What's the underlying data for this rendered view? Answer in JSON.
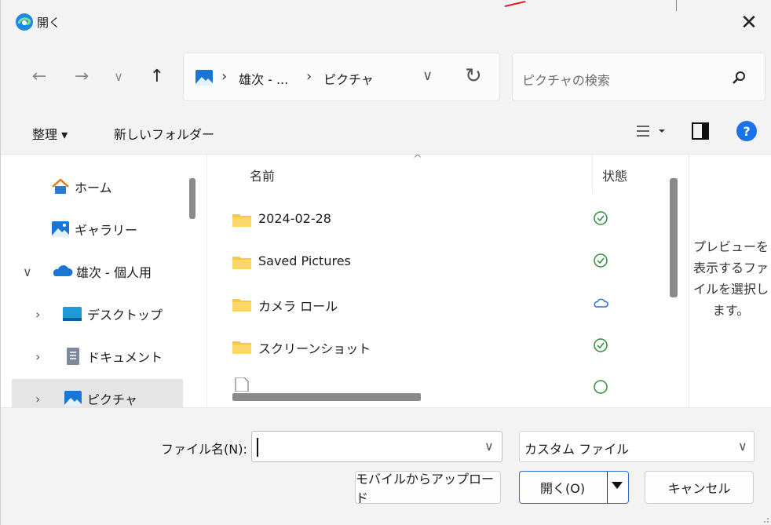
{
  "titlebar": {
    "title": "開く"
  },
  "address": {
    "crumbs": [
      "雄次 - ...",
      "ピクチャ"
    ],
    "separator": "›"
  },
  "search": {
    "placeholder": "ピクチャの検索"
  },
  "toolbar": {
    "organize": "整理 ▾",
    "new_folder": "新しいフォルダー"
  },
  "sidebar": {
    "items": [
      {
        "label": "ホーム",
        "icon": "home-icon"
      },
      {
        "label": "ギャラリー",
        "icon": "gallery-icon"
      },
      {
        "label": "雄次 - 個人用",
        "icon": "onedrive-cloud-icon",
        "expand": "∨"
      },
      {
        "label": "デスクトップ",
        "icon": "desktop-icon",
        "expand": "›"
      },
      {
        "label": "ドキュメント",
        "icon": "document-icon",
        "expand": "›"
      },
      {
        "label": "ピクチャ",
        "icon": "pictures-icon",
        "expand": "›"
      }
    ]
  },
  "file_list": {
    "columns": {
      "name": "名前",
      "status": "状態"
    },
    "rows": [
      {
        "name": "2024-02-28",
        "status": "synced"
      },
      {
        "name": "Saved Pictures",
        "status": "synced"
      },
      {
        "name": "カメラ ロール",
        "status": "cloud"
      },
      {
        "name": "スクリーンショット",
        "status": "synced"
      }
    ]
  },
  "preview": {
    "text": "プレビューを表示するファイルを選択します。"
  },
  "bottom": {
    "filename_label": "ファイル名(N):",
    "filename_value": "",
    "filetype_value": "カスタム ファイル",
    "upload_button": "モバイルからアップロード",
    "open_button": "開く(O)",
    "cancel_button": "キャンセル"
  },
  "colors": {
    "accent": "#1a73e8",
    "folder": "#f6c744",
    "status_green": "#2e8b3a",
    "status_cloud": "#2a6fd1"
  }
}
